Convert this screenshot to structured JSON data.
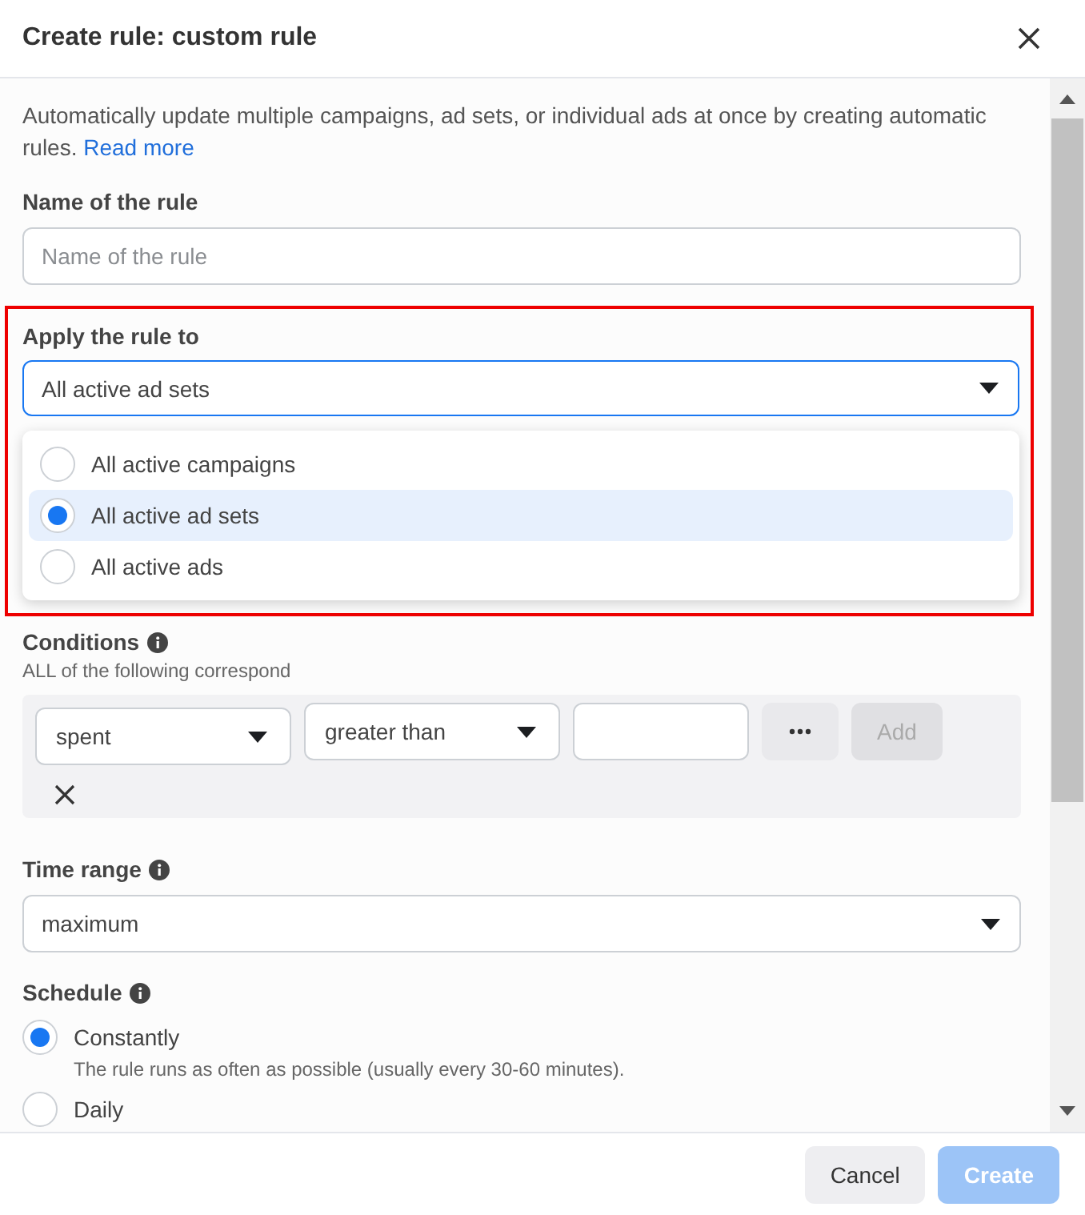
{
  "dialog": {
    "title": "Create rule: custom rule"
  },
  "intro": {
    "text": "Automatically update multiple campaigns, ad sets, or individual ads at once by creating automatic rules.",
    "link": "Read more"
  },
  "name_field": {
    "label": "Name of the rule",
    "placeholder": "Name of the rule"
  },
  "apply_to": {
    "label": "Apply the rule to",
    "value": "All active ad sets",
    "expanded": true,
    "options": [
      {
        "label": "All active campaigns",
        "selected": false
      },
      {
        "label": "All active ad sets",
        "selected": true
      },
      {
        "label": "All active ads",
        "selected": false
      }
    ]
  },
  "conditions": {
    "label": "Conditions",
    "subtitle": "ALL of the following correspond",
    "metric": "spent",
    "operator": "greater than",
    "add_button": {
      "label": "Add",
      "disabled": true
    }
  },
  "time_range": {
    "label": "Time range",
    "value": "maximum"
  },
  "schedule": {
    "label": "Schedule",
    "options": [
      {
        "label": "Constantly",
        "description": "The rule runs as often as possible (usually every 30-60 minutes).",
        "selected": true
      },
      {
        "label": "Daily",
        "selected": false
      }
    ]
  },
  "buttons": [
    {
      "label": "Cancel",
      "kind": "secondary",
      "disabled": false
    },
    {
      "label": "Create",
      "kind": "primary",
      "disabled": true
    }
  ]
}
